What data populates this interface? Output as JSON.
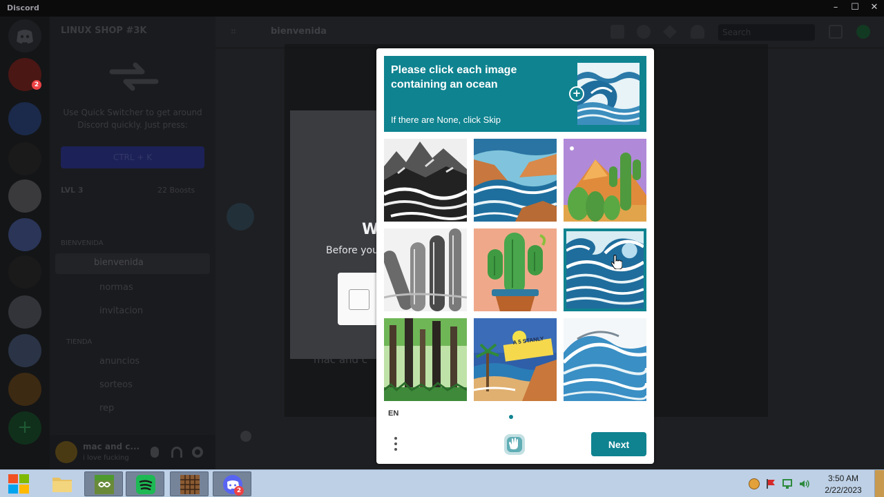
{
  "window": {
    "app_title": "Discord",
    "minimize": "–",
    "maximize": "☐",
    "close": "✕"
  },
  "discord": {
    "server_name": "LINUX SHOP #3K",
    "quick_switcher_text": "Use Quick Switcher to get around Discord quickly. Just press:",
    "shortcut": "CTRL + K",
    "level": "LVL 3",
    "boosts": "22 Boosts",
    "categories": [
      "BIENVENIDA",
      "TIENDA"
    ],
    "channels": [
      "bienvenida",
      "normas",
      "invitacion",
      "anuncios",
      "sorteos",
      "rep"
    ],
    "chat_title": "bienvenida",
    "search_placeholder": "Search",
    "user": {
      "name": "mac and c...",
      "status": "i love fucking"
    },
    "verify_title_partial": "W",
    "verify_sub_partial": "Before you",
    "faded_text": "mac and c"
  },
  "captcha": {
    "prompt_title": "Please click each image containing an ocean",
    "prompt_hint": "If there are None, click Skip",
    "tiles": [
      {
        "icon": "mountains-sketch",
        "selected": false
      },
      {
        "icon": "coastal-waves",
        "selected": false
      },
      {
        "icon": "desert-cactus",
        "selected": false
      },
      {
        "icon": "cactus-sketch",
        "selected": false
      },
      {
        "icon": "potted-cactus",
        "selected": false
      },
      {
        "icon": "ocean-wave",
        "selected": true
      },
      {
        "icon": "forest",
        "selected": false
      },
      {
        "icon": "tropical-beach",
        "selected": false
      },
      {
        "icon": "blue-wave",
        "selected": false
      }
    ],
    "tile_sign_text": "A 5 STANLY",
    "language": "EN",
    "next_label": "Next"
  },
  "taskbar": {
    "time": "3:50 AM",
    "date": "2/22/2023",
    "discord_badge": "2"
  },
  "colors": {
    "teal": "#0f8390",
    "taskbar": "#bdd0e6",
    "discord_bg": "#1f2023"
  }
}
